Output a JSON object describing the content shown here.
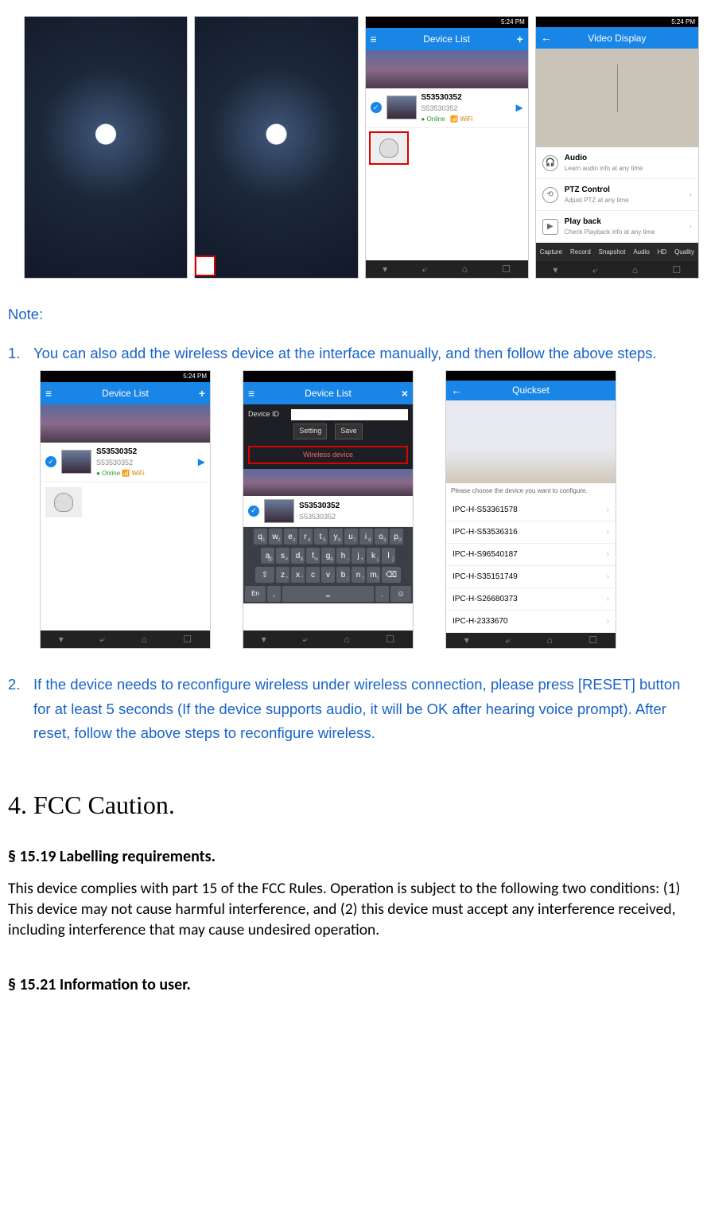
{
  "row1": {
    "status_time": "5:24 PM",
    "device_list_title": "Device List",
    "video_display_title": "Video Display",
    "device": {
      "name": "S53530352",
      "sub": "S53530352",
      "status_online": "Online",
      "status_wifi": "WiFi"
    },
    "menu": [
      {
        "title": "Audio",
        "sub": "Learn audio info at any time"
      },
      {
        "title": "PTZ Control",
        "sub": "Adjust PTZ at any time"
      },
      {
        "title": "Play back",
        "sub": "Check Playback info at any time"
      }
    ],
    "toolbar": [
      "Capture",
      "Record",
      "Snapshot",
      "Audio",
      "HD",
      "Quality"
    ]
  },
  "row2": {
    "device_list_title": "Device List",
    "quickset_title": "Quickset",
    "dialog": {
      "device_id_label": "Device ID",
      "setting_btn": "Setting",
      "save_btn": "Save",
      "wireless_btn": "Wireless device"
    },
    "device": {
      "name": "S53530352",
      "sub": "S53530352"
    },
    "keyboard": {
      "row1": [
        [
          "q",
          "1"
        ],
        [
          "w",
          "2"
        ],
        [
          "e",
          "3"
        ],
        [
          "r",
          "4"
        ],
        [
          "t",
          "5"
        ],
        [
          "y",
          "6"
        ],
        [
          "u",
          "7"
        ],
        [
          "i",
          "8"
        ],
        [
          "o",
          "9"
        ],
        [
          "p",
          "0"
        ]
      ],
      "row2": [
        [
          "a",
          "@"
        ],
        [
          "s",
          "#"
        ],
        [
          "d",
          "$"
        ],
        [
          "f",
          "%"
        ],
        [
          "g",
          "&"
        ],
        [
          "h",
          "-"
        ],
        [
          "j",
          "+"
        ],
        [
          "k",
          "("
        ],
        [
          "l",
          ")"
        ]
      ],
      "row3": [
        [
          "z",
          "*"
        ],
        [
          "x",
          "\""
        ],
        [
          "c",
          "'"
        ],
        [
          "v",
          ":"
        ],
        [
          "b",
          ";"
        ],
        [
          "n",
          "!"
        ],
        [
          "m",
          "?"
        ]
      ],
      "bottom_left": "En",
      "bottom_dot": "."
    },
    "quickset_prompt": "Please choose the device you want to configure.",
    "quickset_items": [
      "IPC-H-S53361578",
      "IPC-H-S53536316",
      "IPC-H-S96540187",
      "IPC-H-S35151749",
      "IPC-H-S26680373",
      "IPC-H-2333670"
    ]
  },
  "text": {
    "note_heading": "Note:",
    "note1_num": "1.",
    "note1": "You can also add the wireless device at the interface manually, and then follow the above steps.",
    "note2_num": "2.",
    "note2": "If the device needs to reconfigure wireless under wireless connection, please press [RESET] button for at least 5 seconds (If the device supports audio, it will be OK after hearing voice prompt). After reset, follow the above steps to reconfigure wireless.",
    "section4": "4. FCC Caution.",
    "s1519_title": "§ 15.19 Labelling requirements.",
    "s1519_body": "This device complies with part 15 of the FCC Rules. Operation is subject to the following two conditions: (1) This device may not cause harmful interference, and (2) this device must accept any interference received, including interference that may cause undesired operation.",
    "s1521_title": "§ 15.21 Information to user."
  }
}
